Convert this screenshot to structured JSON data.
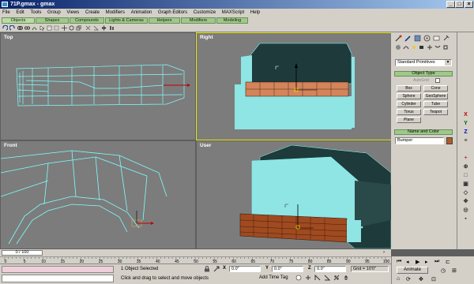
{
  "window": {
    "title": "71P.gmax - gmax"
  },
  "menu": [
    "File",
    "Edit",
    "Tools",
    "Group",
    "Views",
    "Create",
    "Modifiers",
    "Animation",
    "Graph Editors",
    "Customize",
    "MAXScript",
    "Help"
  ],
  "tabs": [
    "Objects",
    "Shapes",
    "Compounds",
    "Lights & Cameras",
    "Helpers",
    "Modifiers",
    "Modeling"
  ],
  "viewports": {
    "top": "Top",
    "right": "Right",
    "front": "Front",
    "user": "User"
  },
  "panel": {
    "category_dropdown": "Standard Primitives",
    "object_type_header": "Object Type",
    "autogrid_label": "AutoGrid",
    "buttons": [
      "Box",
      "Cone",
      "Sphere",
      "GeoSphere",
      "Cylinder",
      "Tube",
      "Torus",
      "Teapot",
      "Plane"
    ],
    "name_color_header": "Name and Color",
    "object_name": "Bumper",
    "object_color": "#b25a2a"
  },
  "timeslider": {
    "label": "0 / 100",
    "progress": 0
  },
  "timeline": {
    "ticks": [
      "0",
      "5",
      "10",
      "15",
      "20",
      "25",
      "30",
      "35",
      "40",
      "45",
      "50",
      "55",
      "60",
      "65",
      "70",
      "75",
      "80",
      "85",
      "90",
      "95",
      "100"
    ]
  },
  "status": {
    "selection": "1 Object Selected",
    "prompt": "Click and drag to select and move objects",
    "x_label": "X",
    "y_label": "Y",
    "z_label": "Z",
    "x_value": "0.0\"",
    "y_value": "0.0\"",
    "z_value": "0.0\"",
    "add_time_tag": "Add Time Tag",
    "grid": "Grid = 10'0\"",
    "animate": "Animate"
  },
  "colors": {
    "mesh_outline": "#7fffff",
    "selected_fill": "#d4845a",
    "viewport_bg": "#7c7c7c",
    "dark_mesh": "#1e3a3a",
    "cyan_face": "#8fe4e4"
  }
}
